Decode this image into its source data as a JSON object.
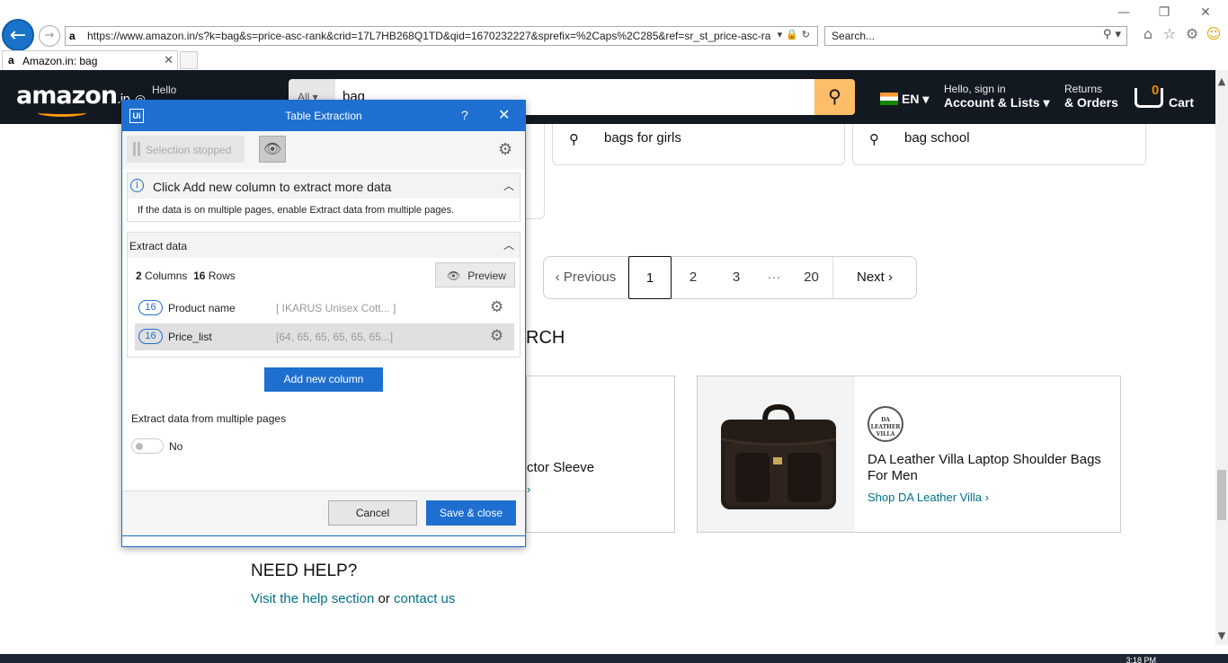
{
  "browser": {
    "url": "https://www.amazon.in/s?k=bag&s=price-asc-rank&crid=17L7HB268Q1TD&qid=1670232227&sprefix=%2Caps%2C285&ref=sr_st_price-asc-ran",
    "search_placeholder": "Search...",
    "tab_title": "Amazon.in: bag"
  },
  "amazon": {
    "hello": "Hello",
    "category": "All",
    "query": "bag",
    "lang": "EN",
    "account_line1": "Hello, sign in",
    "account_line2": "Account & Lists",
    "orders_line1": "Returns",
    "orders_line2": "& Orders",
    "cart_count": "0",
    "cart_label": "Cart"
  },
  "suggestions": [
    "bags for girls",
    "bag school"
  ],
  "pagination": {
    "previous": "Previous",
    "pages": [
      "1",
      "2",
      "3",
      "20"
    ],
    "ellipsis": "···",
    "next": "Next",
    "current": "1"
  },
  "section_fragment": "RCH",
  "cards": {
    "left_text": "ctor Sleeve",
    "right_title": "DA Leather Villa Laptop Shoulder Bags For Men",
    "right_link": "Shop DA Leather Villa ›",
    "right_logo_text": "DA LEATHER VILLA"
  },
  "help": {
    "heading": "NEED HELP?",
    "visit": "Visit the help section",
    "or": "or",
    "contact": "contact us"
  },
  "taskbar": {
    "time": "3:18 PM"
  },
  "dialog": {
    "title": "Table Extraction",
    "help": "?",
    "selection_status": "Selection stopped",
    "info_title": "Click Add new column to extract more data",
    "info_desc": "If the data is on multiple pages, enable Extract data from multiple pages.",
    "extract_title": "Extract data",
    "columns_count": "2",
    "columns_label": "Columns",
    "rows_count": "16",
    "rows_label": "Rows",
    "preview": "Preview",
    "columns": [
      {
        "count": "16",
        "name": "Product name",
        "preview": "[ IKARUS Unisex Cott... ]"
      },
      {
        "count": "16",
        "name": "Price_list",
        "preview": "[64, 65, 65, 65, 65, 65...]"
      }
    ],
    "add_column": "Add new column",
    "multi_pages_label": "Extract data from multiple pages",
    "multi_pages_value": "No",
    "cancel": "Cancel",
    "save": "Save & close"
  }
}
